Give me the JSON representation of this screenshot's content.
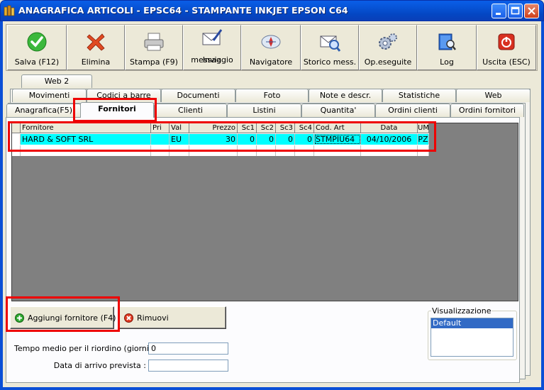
{
  "window": {
    "title": "ANAGRAFICA ARTICOLI - EPSC64 - STAMPANTE INKJET EPSON C64"
  },
  "toolbar": {
    "buttons": [
      {
        "label": "Salva (F12)",
        "icon": "check-icon"
      },
      {
        "label": "Elimina",
        "icon": "x-delete-icon"
      },
      {
        "label": "Stampa (F9)",
        "icon": "printer-icon"
      },
      {
        "label": "Invia messaggio",
        "line1": "Invia",
        "line2": "messaggio",
        "icon": "envelope-pen-icon"
      },
      {
        "label": "Navigatore",
        "icon": "compass-icon"
      },
      {
        "label": "Storico mess.",
        "icon": "envelope-search-icon"
      },
      {
        "label": "Op.eseguite",
        "icon": "gears-icon"
      },
      {
        "label": "Log",
        "icon": "book-search-icon"
      },
      {
        "label": "Uscita (ESC)",
        "icon": "power-icon"
      }
    ]
  },
  "tabs": {
    "row3": [
      "Web 2"
    ],
    "row2": [
      "Movimenti",
      "Codici a barre",
      "Documenti",
      "Foto",
      "Note e descr.",
      "Statistiche",
      "Web"
    ],
    "row1": [
      "Anagrafica(F5)",
      "Fornitori",
      "Clienti",
      "Listini",
      "Quantita'",
      "Ordini clienti",
      "Ordini fornitori"
    ],
    "active": "Fornitori"
  },
  "grid": {
    "columns": [
      "Fornitore",
      "Pri",
      "Val",
      "Prezzo",
      "Sc1",
      "Sc2",
      "Sc3",
      "Sc4",
      "Cod. Art",
      "Data",
      "UM"
    ],
    "rows": [
      [
        "HARD & SOFT SRL",
        "",
        "EU",
        "30",
        "0",
        "0",
        "0",
        "0",
        "STMPIU64",
        "04/10/2006",
        "PZ"
      ]
    ]
  },
  "actions": {
    "add_supplier": "Aggiungi fornitore (F4)",
    "remove": "Rimuovi"
  },
  "visualizzazione": {
    "legend": "Visualizzazione",
    "items": [
      "Default"
    ]
  },
  "form": {
    "tempo_label": "Tempo medio per il riordino (giorni) :",
    "tempo_value": "0",
    "data_label": "Data di arrivo prevista :",
    "data_value": ""
  },
  "colors": {
    "title_bar": "#0753d6",
    "selected_row": "#00ffff",
    "highlight": "#ee0000",
    "list_selection": "#316ac5"
  }
}
